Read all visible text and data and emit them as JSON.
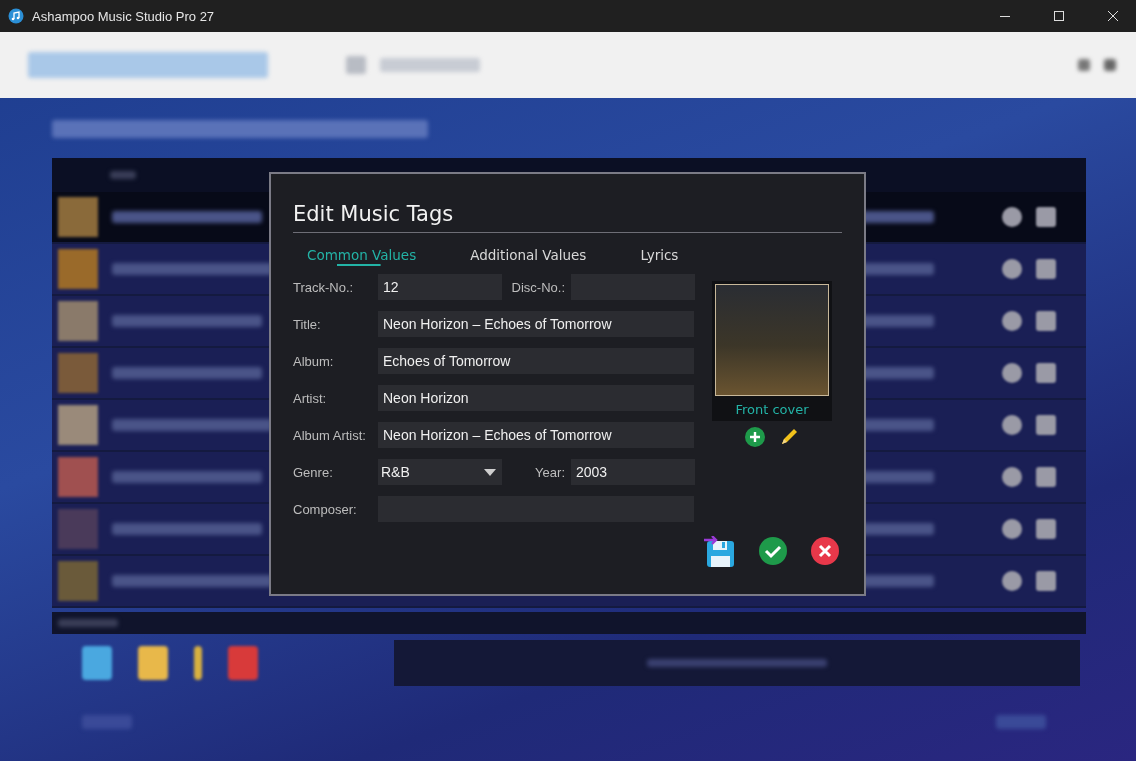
{
  "window": {
    "title": "Ashampoo Music Studio Pro 27"
  },
  "background": {
    "rows": [
      {
        "selected": true
      },
      {
        "selected": false
      },
      {
        "selected": false
      },
      {
        "selected": false
      },
      {
        "selected": false
      },
      {
        "selected": false
      },
      {
        "selected": false
      },
      {
        "selected": false
      }
    ]
  },
  "dialog": {
    "title": "Edit Music Tags",
    "tabs": [
      {
        "label": "Common Values",
        "selected": true
      },
      {
        "label": "Additional Values",
        "selected": false
      },
      {
        "label": "Lyrics",
        "selected": false
      }
    ],
    "rows": [
      [
        {
          "kind": "short",
          "label": "Track-No.:",
          "value": "12"
        },
        {
          "kind": "short",
          "label": "Disc-No.:"
        }
      ],
      [
        {
          "kind": "wide",
          "label": "Title:",
          "value": "Neon Horizon – Echoes of Tomorrow"
        }
      ],
      [
        {
          "kind": "wide",
          "label": "Album:",
          "value": "Echoes of Tomorrow"
        }
      ],
      [
        {
          "kind": "wide",
          "label": "Artist:",
          "value": "Neon Horizon"
        }
      ],
      [
        {
          "kind": "wide",
          "label": "Album Artist:",
          "value": "Neon Horizon – Echoes of Tomorrow"
        }
      ],
      [
        {
          "kind": "dropdown",
          "label": "Genre:",
          "value": "R&B"
        },
        {
          "kind": "short",
          "label": "Year:",
          "value": "2003"
        }
      ],
      [
        {
          "kind": "wide",
          "label": "Composer:"
        }
      ]
    ],
    "cover": {
      "caption": "Front cover"
    }
  }
}
